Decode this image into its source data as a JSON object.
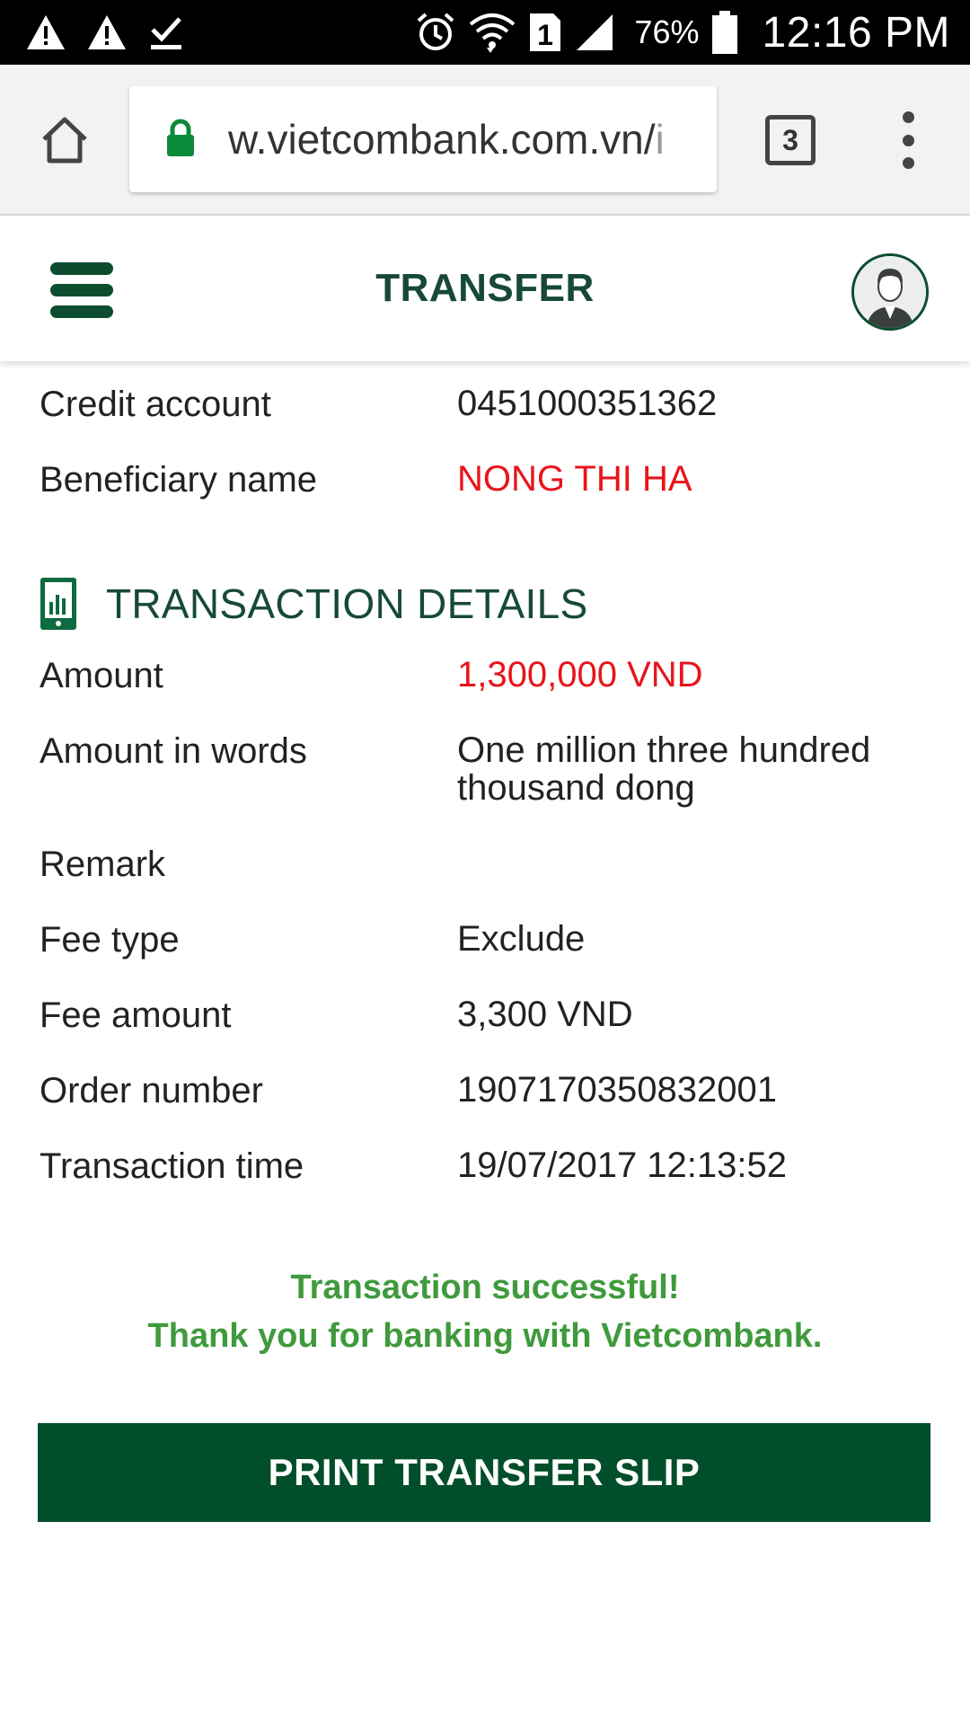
{
  "status_bar": {
    "battery_percent": "76%",
    "time": "12:16 PM",
    "sim_number": "1",
    "icons": [
      "warning-icon",
      "warning-icon",
      "download-done-icon",
      "alarm-icon",
      "wifi-icon",
      "sim-icon",
      "signal-icon",
      "battery-icon"
    ]
  },
  "browser": {
    "url_main": "w.vietcombank.com.vn/",
    "url_faded": "i",
    "tab_count": "3"
  },
  "header": {
    "title": "TRANSFER"
  },
  "beneficiary": {
    "credit_account_label": "Credit account",
    "credit_account_value": "0451000351362",
    "beneficiary_name_label": "Beneficiary name",
    "beneficiary_name_value": "NONG THI HA"
  },
  "transaction_details": {
    "section_title": "TRANSACTION DETAILS",
    "amount_label": "Amount",
    "amount_value": "1,300,000 VND",
    "amount_words_label": "Amount in words",
    "amount_words_value": "One million three hundred thousand dong",
    "remark_label": "Remark",
    "remark_value": "",
    "fee_type_label": "Fee type",
    "fee_type_value": "Exclude",
    "fee_amount_label": "Fee amount",
    "fee_amount_value": "3,300 VND",
    "order_number_label": "Order number",
    "order_number_value": "1907170350832001",
    "transaction_time_label": "Transaction time",
    "transaction_time_value": "19/07/2017 12:13:52"
  },
  "messages": {
    "success_line1": "Transaction successful!",
    "success_line2": "Thank you for banking with Vietcombank."
  },
  "actions": {
    "print_label": "PRINT TRANSFER SLIP"
  },
  "colors": {
    "brand_green": "#004e2a",
    "success_green": "#3f9a3c",
    "highlight_red": "#e8141b",
    "title_green": "#174a35"
  }
}
